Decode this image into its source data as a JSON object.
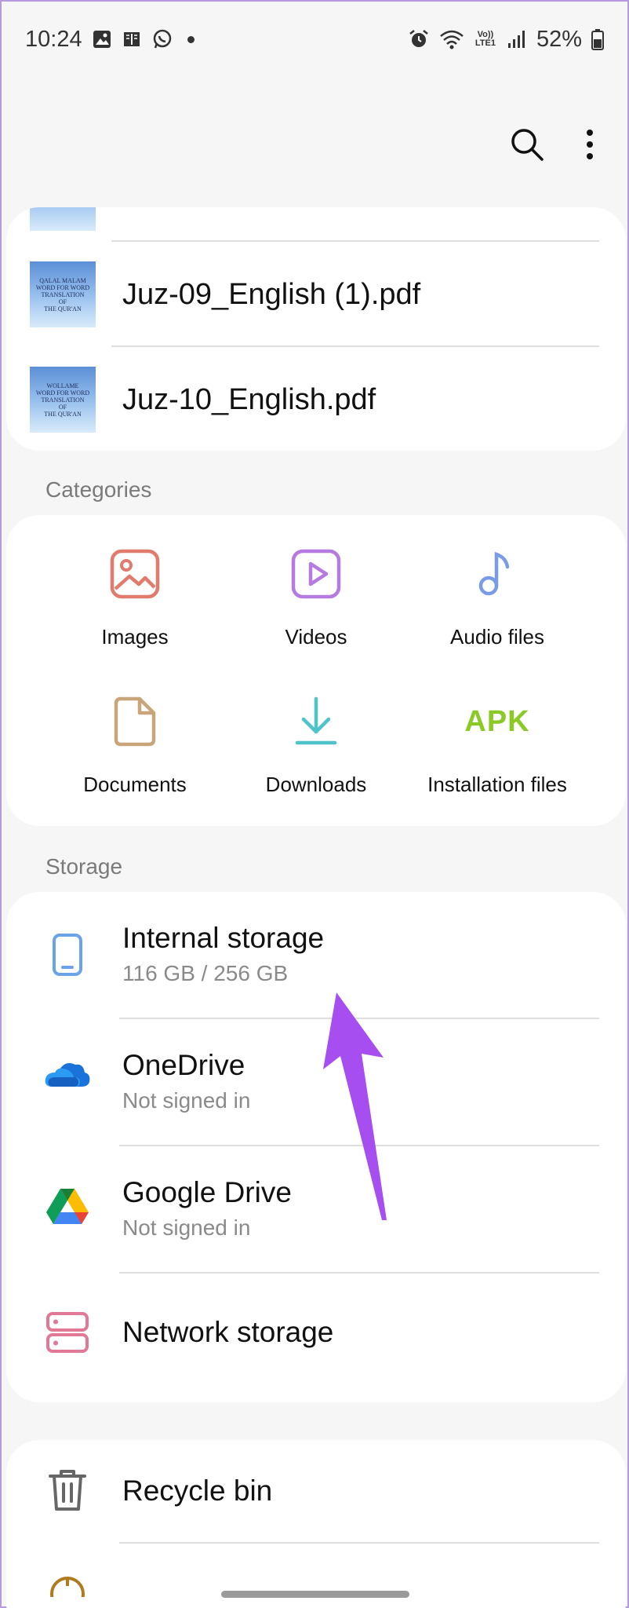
{
  "status_bar": {
    "time": "10:24",
    "icons_left": [
      "gallery-icon",
      "book-icon",
      "whatsapp-icon",
      "dot-icon"
    ],
    "icons_right": [
      "alarm-icon",
      "wifi-icon",
      "volte-icon",
      "signal-icon"
    ],
    "volte_label": "Vo)) LTE1",
    "battery": "52%"
  },
  "toolbar": {
    "actions": [
      "search-icon",
      "more-options-icon"
    ]
  },
  "recent_files": [
    {
      "name": "Juz-09_English (1).pdf",
      "thumb_lines": [
        "QALAL MALAM",
        "WORD FOR WORD",
        "TRANSLATION",
        "OF",
        "THE QUR'AN"
      ]
    },
    {
      "name": "Juz-10_English.pdf",
      "thumb_lines": [
        "WOLLAME",
        "WORD FOR WORD",
        "TRANSLATION",
        "OF",
        "THE QUR'AN"
      ]
    }
  ],
  "categories": {
    "label": "Categories",
    "items": [
      {
        "label": "Images",
        "icon": "images-icon",
        "color": "#e07b6e"
      },
      {
        "label": "Videos",
        "icon": "videos-icon",
        "color": "#b57be0"
      },
      {
        "label": "Audio files",
        "icon": "audio-icon",
        "color": "#7a9be6"
      },
      {
        "label": "Documents",
        "icon": "document-icon",
        "color": "#c9a679"
      },
      {
        "label": "Downloads",
        "icon": "download-icon",
        "color": "#4fc3c9"
      },
      {
        "label": "Installation files",
        "icon": "apk-icon",
        "color": "#8bc926",
        "icon_text": "APK"
      }
    ]
  },
  "storage": {
    "label": "Storage",
    "items": [
      {
        "title": "Internal storage",
        "subtitle": "116 GB / 256 GB",
        "icon": "phone-icon"
      },
      {
        "title": "OneDrive",
        "subtitle": "Not signed in",
        "icon": "onedrive-icon"
      },
      {
        "title": "Google Drive",
        "subtitle": "Not signed in",
        "icon": "google-drive-icon"
      },
      {
        "title": "Network storage",
        "subtitle": "",
        "icon": "network-storage-icon"
      }
    ]
  },
  "other": {
    "items": [
      {
        "title": "Recycle bin",
        "icon": "trash-icon"
      }
    ]
  },
  "colors": {
    "annotation_arrow": "#a64ef0",
    "background": "#f6f6f6"
  }
}
